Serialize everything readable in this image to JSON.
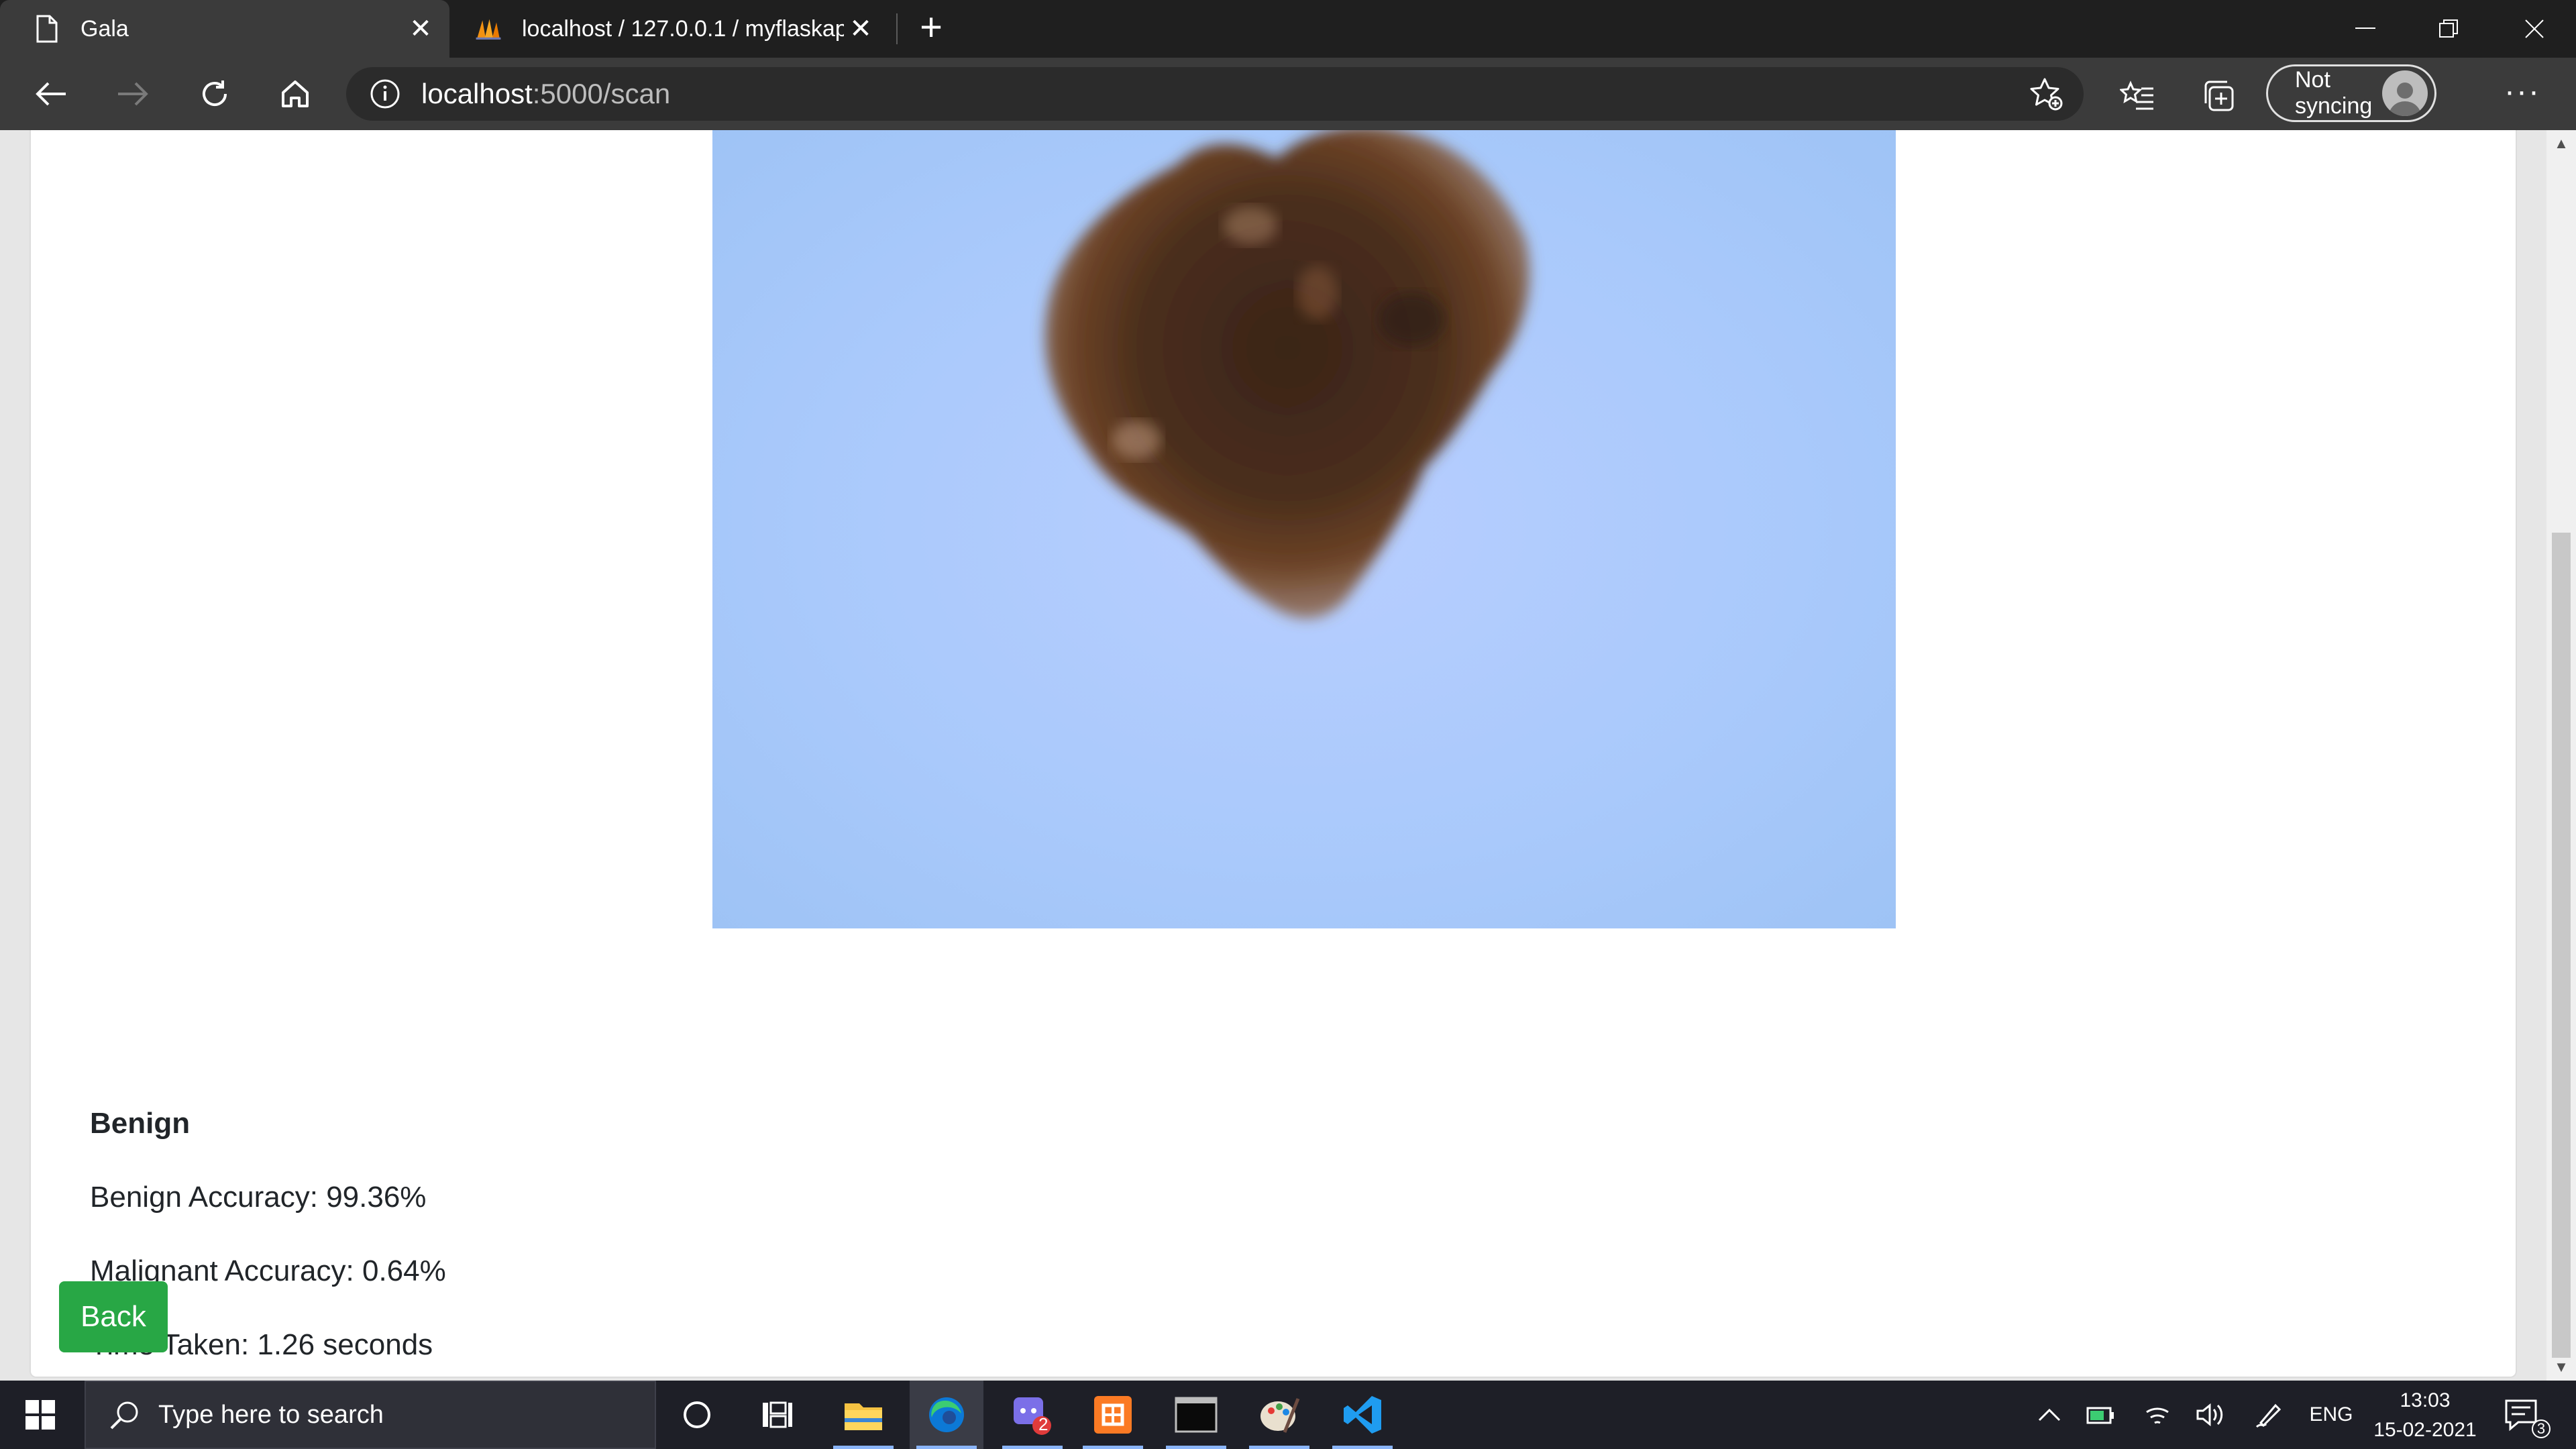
{
  "browser": {
    "tabs": [
      {
        "title": "Gala",
        "active": true
      },
      {
        "title": "localhost / 127.0.0.1 / myflaskapp",
        "active": false
      }
    ],
    "address": {
      "host": "localhost",
      "path": ":5000/scan"
    },
    "sync_label": "Not syncing"
  },
  "page": {
    "result_label": "Benign",
    "benign_accuracy": "Benign Accuracy: 99.36%",
    "malignant_accuracy": "Malignant Accuracy: 0.64%",
    "time_taken": "Time Taken: 1.26 seconds",
    "back_label": "Back"
  },
  "taskbar": {
    "search_placeholder": "Type here to search",
    "language": "ENG",
    "time": "13:03",
    "date": "15-02-2021",
    "chat_badge": "2",
    "notification_count": "3"
  },
  "colors": {
    "back_button": "#28a745",
    "taskbar": "#1e1f27",
    "browser_chrome": "#3b3b3b"
  }
}
